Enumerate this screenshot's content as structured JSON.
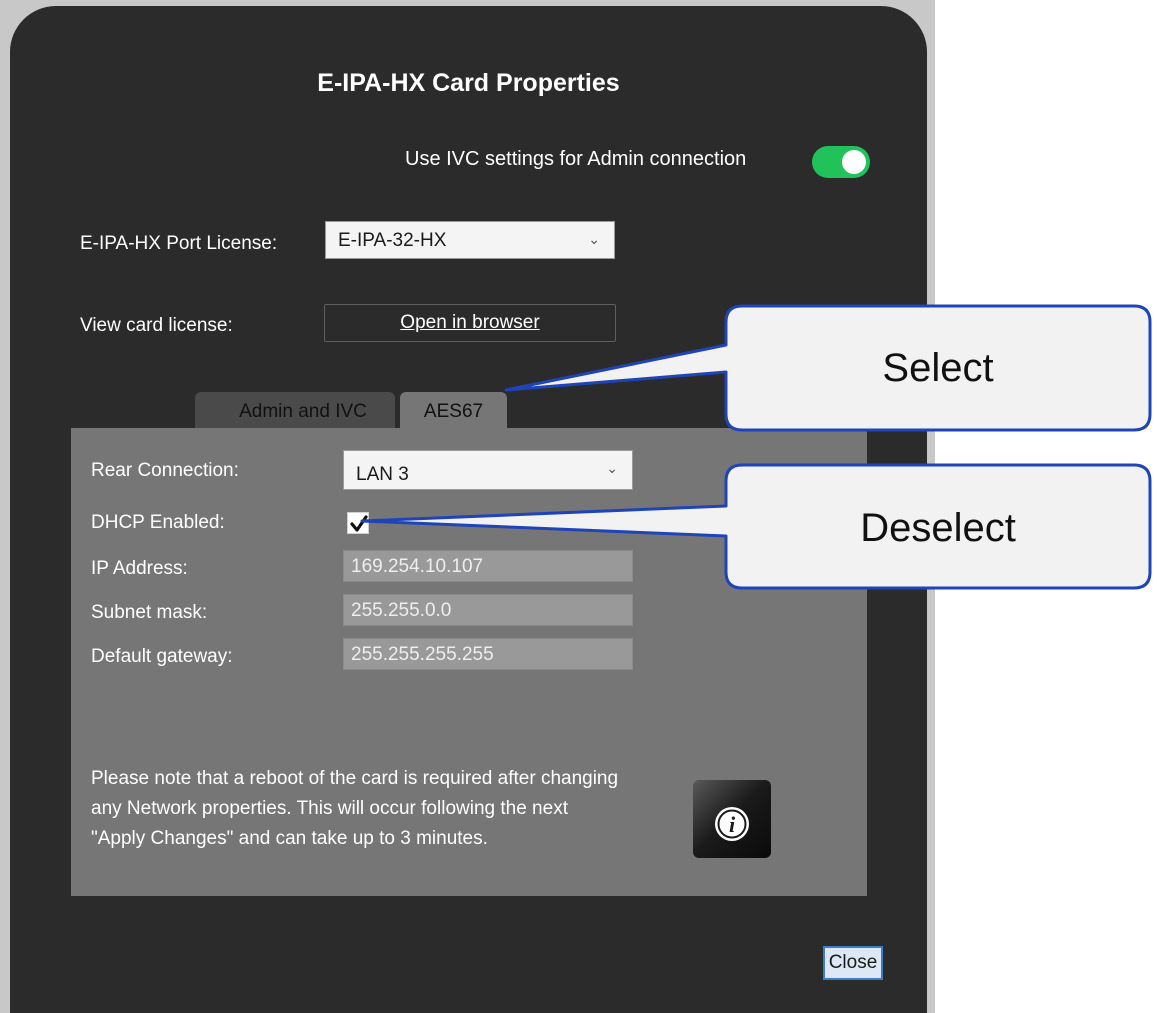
{
  "dialog": {
    "title": "E-IPA-HX Card Properties",
    "ivc_toggle": {
      "label": "Use IVC settings for Admin connection",
      "on": true,
      "color": "#21c25a"
    },
    "port_license": {
      "label": "E-IPA-HX Port License:",
      "value": "E-IPA-32-HX"
    },
    "card_license": {
      "label": "View card license:",
      "button": "Open in browser"
    },
    "tabs": [
      {
        "label": "Admin and IVC",
        "active": false
      },
      {
        "label": "AES67",
        "active": true
      }
    ],
    "aes67": {
      "rear_connection": {
        "label": "Rear Connection:",
        "value": "LAN 3"
      },
      "dhcp": {
        "label": "DHCP Enabled:",
        "checked": true
      },
      "ip_address": {
        "label": "IP Address:",
        "value": "169.254.10.107"
      },
      "subnet_mask": {
        "label": "Subnet mask:",
        "value": "255.255.0.0"
      },
      "default_gateway": {
        "label": "Default gateway:",
        "value": "255.255.255.255"
      },
      "note": "Please note that a reboot of the card is required after changing any Network properties. This will occur following the next \"Apply Changes\" and can take up to 3 minutes."
    },
    "close_button": "Close"
  },
  "callouts": [
    {
      "text": "Select"
    },
    {
      "text": "Deselect"
    }
  ]
}
